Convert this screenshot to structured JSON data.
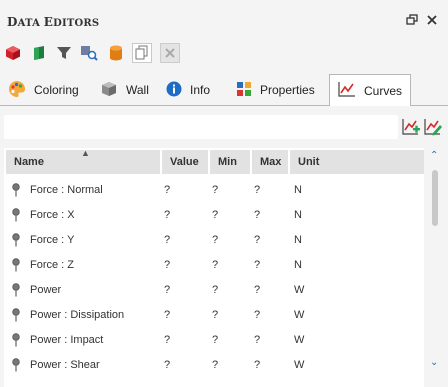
{
  "window": {
    "title_first": "D",
    "title_rest": "ATA ",
    "title_second": "E",
    "title_rest2": "DITORS"
  },
  "tabs": [
    {
      "label": "Coloring",
      "icon": "palette-icon"
    },
    {
      "label": "Wall",
      "icon": "wall-icon"
    },
    {
      "label": "Info",
      "icon": "info-icon"
    },
    {
      "label": "Properties",
      "icon": "properties-icon"
    },
    {
      "label": "Curves",
      "icon": "curves-icon",
      "active": true
    }
  ],
  "table": {
    "columns": [
      "Name",
      "Value",
      "Min",
      "Max",
      "Unit"
    ],
    "rows": [
      {
        "name": "Force : Normal",
        "value": "?",
        "min": "?",
        "max": "?",
        "unit": "N"
      },
      {
        "name": "Force : X",
        "value": "?",
        "min": "?",
        "max": "?",
        "unit": "N"
      },
      {
        "name": "Force : Y",
        "value": "?",
        "min": "?",
        "max": "?",
        "unit": "N"
      },
      {
        "name": "Force : Z",
        "value": "?",
        "min": "?",
        "max": "?",
        "unit": "N"
      },
      {
        "name": "Power",
        "value": "?",
        "min": "?",
        "max": "?",
        "unit": "W"
      },
      {
        "name": "Power : Dissipation",
        "value": "?",
        "min": "?",
        "max": "?",
        "unit": "W"
      },
      {
        "name": "Power : Impact",
        "value": "?",
        "min": "?",
        "max": "?",
        "unit": "W"
      },
      {
        "name": "Power : Shear",
        "value": "?",
        "min": "?",
        "max": "?",
        "unit": "W"
      }
    ]
  },
  "colors": {
    "accent_blue": "#2a6ebb",
    "tab_border": "#b7b7b7"
  }
}
